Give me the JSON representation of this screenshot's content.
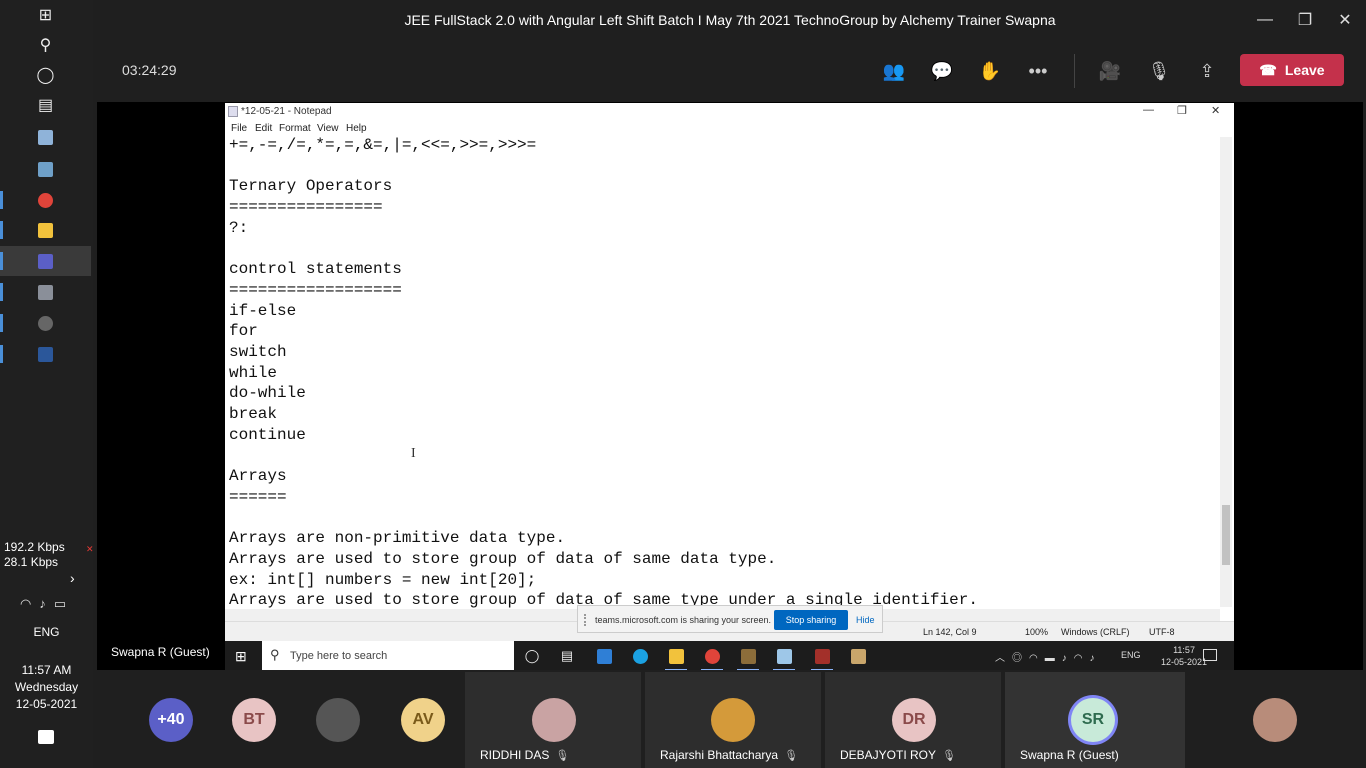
{
  "left_taskbar": {
    "network_down": "192.2 Kbps",
    "network_up": "28.1 Kbps",
    "language": "ENG",
    "time": "11:57 AM",
    "day": "Wednesday",
    "date": "12-05-2021"
  },
  "teams": {
    "window_title": "JEE FullStack 2.0 with Angular Left Shift Batch I May 7th 2021 TechnoGroup by Alchemy Trainer Swapna",
    "meeting_timer": "03:24:29",
    "leave_label": "Leave",
    "presenter_name": "Swapna R (Guest)"
  },
  "notepad": {
    "title": "*12-05-21 - Notepad",
    "menu": [
      "File",
      "Edit",
      "Format",
      "View",
      "Help"
    ],
    "lines": [
      "+=,-=,/=,*=,=,&=,|=,<<=,>>=,>>>=",
      "",
      "Ternary Operators",
      "================",
      "?:",
      "",
      "control statements",
      "==================",
      "if-else",
      "for",
      "switch",
      "while",
      "do-while",
      "break",
      "continue",
      "",
      "Arrays",
      "======",
      "",
      "Arrays are non-primitive data type.",
      "Arrays are used to store group of data of same data type.",
      "ex: int[] numbers = new int[20];",
      "Arrays are used to store group of data of same type under a single identifier."
    ],
    "status": {
      "position": "Ln 142, Col 9",
      "zoom": "100%",
      "line_ending": "Windows (CRLF)",
      "encoding": "UTF-8"
    }
  },
  "share_banner": {
    "message": "teams.microsoft.com is sharing your screen.",
    "stop_label": "Stop sharing",
    "hide_label": "Hide"
  },
  "shared_taskbar": {
    "search_placeholder": "Type here to search",
    "language": "ENG",
    "time": "11:57",
    "date": "12-05-2021"
  },
  "participants": [
    {
      "initials": "+40",
      "color": "#5b5fc7",
      "name": ""
    },
    {
      "initials": "BT",
      "color": "#e8c4c4",
      "name": ""
    },
    {
      "initials": "",
      "color": "#555555",
      "name": ""
    },
    {
      "initials": "AV",
      "color": "#f0d28a",
      "name": ""
    },
    {
      "initials": "",
      "color": "#c9a3a3",
      "name": "RIDDHI DAS"
    },
    {
      "initials": "",
      "color": "#d49a3a",
      "name": "Rajarshi Bhattacharya"
    },
    {
      "initials": "DR",
      "color": "#e8c4c4",
      "name": "DEBAJYOTI ROY"
    },
    {
      "initials": "SR",
      "color": "#c8ead9",
      "name": "Swapna R (Guest)"
    },
    {
      "initials": "",
      "color": "#b88c7a",
      "name": ""
    }
  ]
}
